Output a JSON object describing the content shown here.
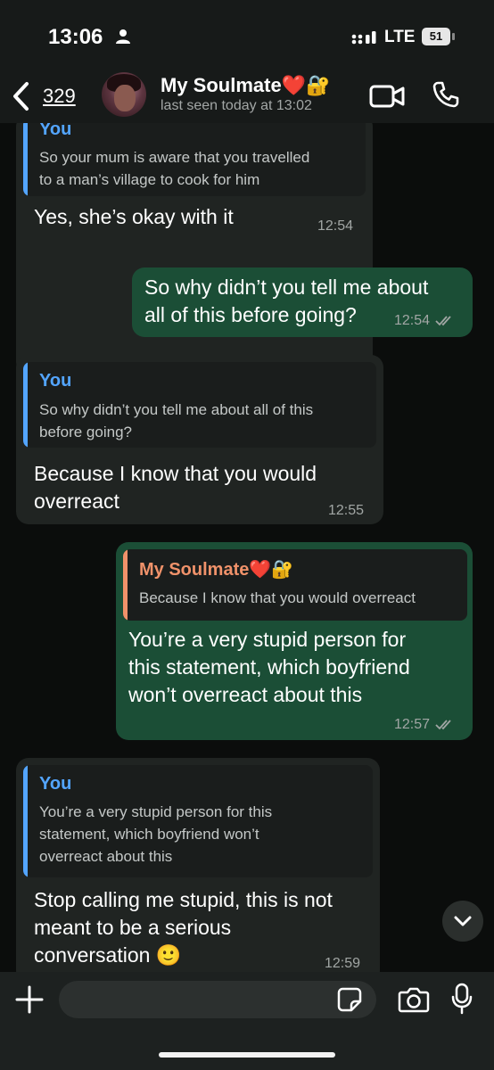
{
  "status_bar": {
    "time": "13:06",
    "network": "LTE",
    "battery": "51",
    "icons": [
      "person-icon",
      "signal-icon",
      "battery-icon"
    ]
  },
  "header": {
    "back_count": "329",
    "contact_name": "My Soulmate❤️🔐",
    "last_seen": "last seen today at 13:02",
    "icons": [
      "back-chevron-icon",
      "video-call-icon",
      "phone-icon"
    ]
  },
  "colors": {
    "incoming_bubble": "#202422",
    "outgoing_bubble": "#1b4e36",
    "you_quote_accent": "#53a5ff",
    "soulmate_quote_accent": "#f0926a"
  },
  "messages": [
    {
      "direction": "incoming",
      "quote": {
        "author": "You",
        "text_lines": [
          "So your mum is aware that you travelled",
          "to a man’s village to cook for him"
        ]
      },
      "text_lines": [
        "Yes, she’s okay with it"
      ],
      "time": "12:54"
    },
    {
      "direction": "outgoing",
      "text_lines": [
        "So why didn’t you tell me about",
        "all of this before going?"
      ],
      "time": "12:54"
    },
    {
      "direction": "incoming",
      "quote": {
        "author": "You",
        "text_lines": [
          "So why didn’t you tell me about all of this",
          "before going?"
        ]
      },
      "text_lines": [
        "Because I know that you would",
        "overreact"
      ],
      "time": "12:55"
    },
    {
      "direction": "outgoing",
      "quote": {
        "author": "My Soulmate❤️🔐",
        "text_lines": [
          "Because I know that you would overreact"
        ]
      },
      "text_lines": [
        "You’re a very stupid person for",
        "this statement, which boyfriend",
        "won’t overreact about this"
      ],
      "time": "12:57"
    },
    {
      "direction": "incoming",
      "quote": {
        "author": "You",
        "text_lines": [
          "You’re a very stupid person for this",
          "statement, which boyfriend won’t",
          "overreact about this"
        ]
      },
      "text_lines": [
        "Stop calling me stupid, this is not",
        "meant to be a serious",
        "conversation 🙂"
      ],
      "time": "12:59"
    }
  ],
  "input_bar": {
    "placeholder": "",
    "icons": [
      "plus-icon",
      "sticker-icon",
      "camera-icon",
      "mic-icon"
    ]
  }
}
